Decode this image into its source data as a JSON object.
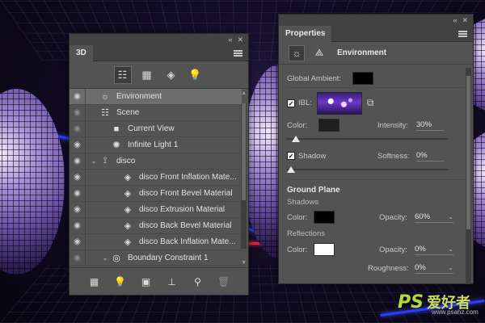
{
  "panel_3d": {
    "tab": "3D",
    "toolbar": [
      {
        "name": "whole-scene-filter-icon",
        "glyph": "☷",
        "active": true
      },
      {
        "name": "meshes-filter-icon",
        "glyph": "▦",
        "active": false
      },
      {
        "name": "materials-filter-icon",
        "glyph": "◈",
        "active": false
      },
      {
        "name": "lights-filter-icon",
        "glyph": "💡",
        "active": false
      }
    ],
    "layers": [
      {
        "label": "Environment",
        "indent": 0,
        "twisty": "",
        "icon": "☼",
        "eye": true,
        "selected": true
      },
      {
        "label": "Scene",
        "indent": 0,
        "twisty": "",
        "icon": "☷",
        "eye": false,
        "selected": false
      },
      {
        "label": "Current View",
        "indent": 1,
        "twisty": "",
        "icon": "■",
        "eye": false,
        "selected": false
      },
      {
        "label": "Infinite Light 1",
        "indent": 1,
        "twisty": "",
        "icon": "✺",
        "eye": true,
        "selected": false
      },
      {
        "label": "disco",
        "indent": 0,
        "twisty": "⌄",
        "icon": "⟟",
        "eye": true,
        "selected": false
      },
      {
        "label": "disco Front Inflation Mate...",
        "indent": 2,
        "twisty": "",
        "icon": "◈",
        "eye": true,
        "selected": false
      },
      {
        "label": "disco Front Bevel Material",
        "indent": 2,
        "twisty": "",
        "icon": "◈",
        "eye": true,
        "selected": false
      },
      {
        "label": "disco Extrusion Material",
        "indent": 2,
        "twisty": "",
        "icon": "◈",
        "eye": true,
        "selected": false
      },
      {
        "label": "disco Back Bevel Material",
        "indent": 2,
        "twisty": "",
        "icon": "◈",
        "eye": true,
        "selected": false
      },
      {
        "label": "disco Back Inflation Mate...",
        "indent": 2,
        "twisty": "",
        "icon": "◈",
        "eye": true,
        "selected": false
      },
      {
        "label": "Boundary Constraint 1",
        "indent": 1,
        "twisty": "⌄",
        "icon": "◎",
        "eye": false,
        "selected": false
      }
    ],
    "bottom_icons": [
      {
        "name": "new-mesh-icon",
        "glyph": "▦",
        "disabled": false
      },
      {
        "name": "new-light-icon",
        "glyph": "💡",
        "disabled": false
      },
      {
        "name": "render-icon",
        "glyph": "▣",
        "disabled": false
      },
      {
        "name": "drop-to-ground-icon",
        "glyph": "⊥",
        "disabled": false
      },
      {
        "name": "add-constraint-icon",
        "glyph": "⚲",
        "disabled": false
      },
      {
        "name": "delete-icon",
        "glyph": "🗑",
        "disabled": true
      }
    ]
  },
  "properties": {
    "tab": "Properties",
    "title": "Environment",
    "global_ambient_label": "Global Ambient:",
    "ibl_label": "IBL:",
    "ibl_checked": true,
    "color_label": "Color:",
    "intensity_label": "Intensity:",
    "intensity_value": "30%",
    "shadow_label": "Shadow",
    "shadow_checked": true,
    "softness_label": "Softness:",
    "softness_value": "0%",
    "ground_plane_label": "Ground Plane",
    "shadows_label": "Shadows",
    "shadows_color_label": "Color:",
    "shadows_opacity_label": "Opacity:",
    "shadows_opacity_value": "60%",
    "reflections_label": "Reflections",
    "reflections_color_label": "Color:",
    "reflections_opacity_label": "Opacity:",
    "reflections_opacity_value": "0%",
    "roughness_label": "Roughness:",
    "roughness_value": "0%"
  },
  "watermark": {
    "logo": "PS",
    "text": "爱好者",
    "url": "www.psahz.com"
  },
  "colors": {
    "panel_bg": "#535353",
    "panel_header": "#424242",
    "selected_row": "#6d6d6d",
    "global_ambient": "#000000",
    "ibl_color": "#1e1e1e",
    "shadows_color": "#000000",
    "reflections_color": "#ffffff"
  }
}
